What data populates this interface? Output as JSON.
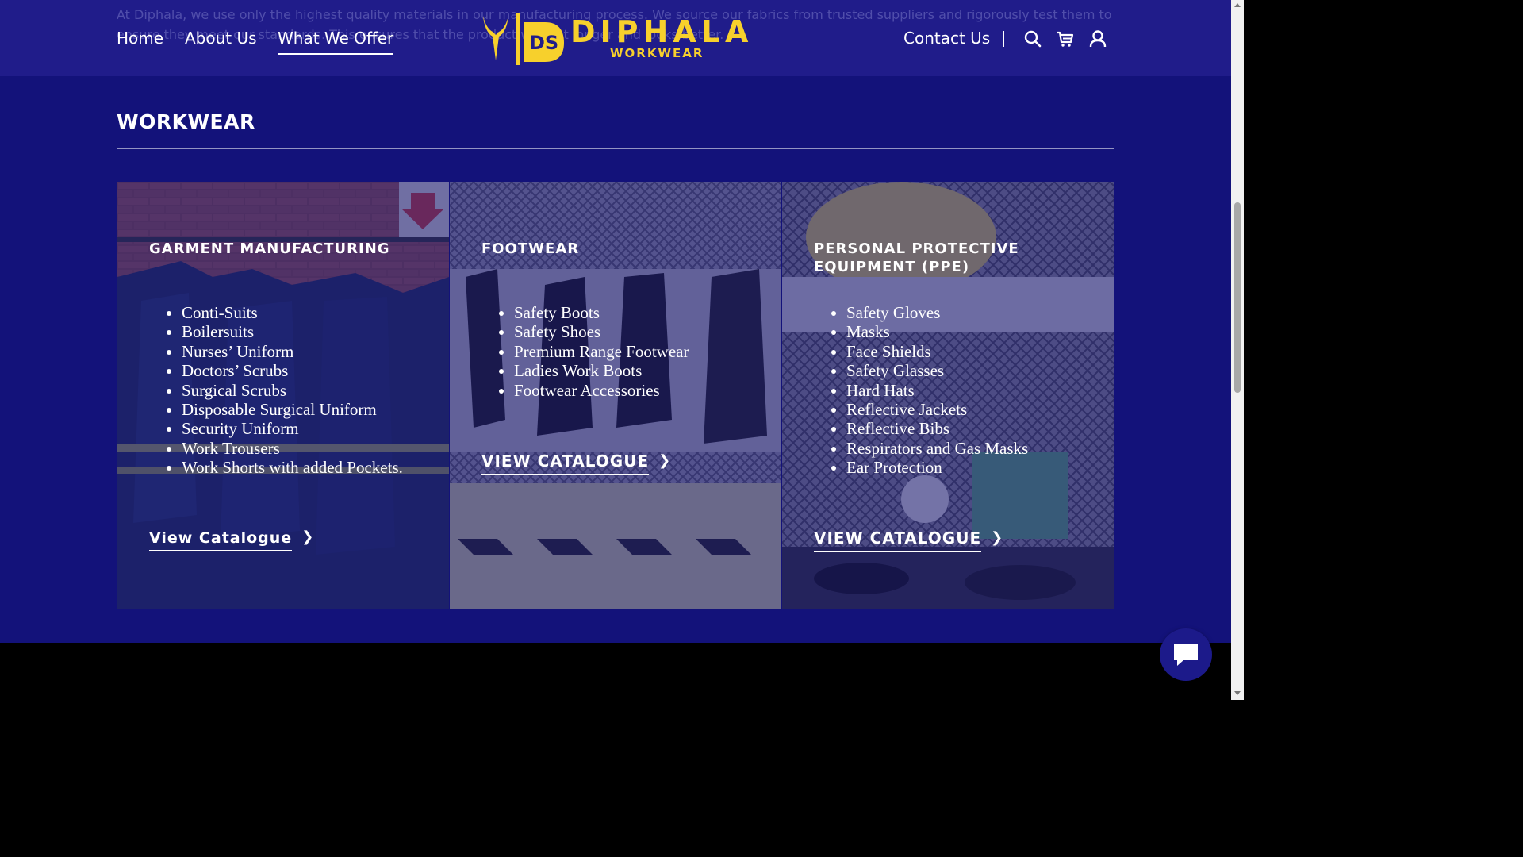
{
  "header": {
    "behind_text": "At Diphala, we use only the highest quality materials in our manufacturing process. We source our fabrics from trusted suppliers and rigorously test them to ensure they meet our standards. This ensures that the product will last longer and looks better.",
    "nav": {
      "home": "Home",
      "about": "About Us",
      "offer": "What We Offer",
      "contact": "Contact Us"
    },
    "logo": {
      "mark": "DS",
      "brand": "DIPHALA",
      "sub": "WORKWEAR"
    },
    "icons": [
      "search-icon",
      "cart-icon",
      "user-icon"
    ]
  },
  "section": {
    "title": "WORKWEAR"
  },
  "cards": [
    {
      "title": "GARMENT MANUFACTURING",
      "items": [
        "Conti-Suits",
        "Boilersuits",
        "Nurses’ Uniform",
        "Doctors’ Scrubs",
        "Surgical Scrubs",
        "Disposable Surgical Uniform",
        "Security Uniform",
        "Work Trousers",
        "Work Shorts with added Pockets."
      ],
      "link": "View Catalogue"
    },
    {
      "title": "FOOTWEAR",
      "items": [
        "Safety Boots",
        "Safety Shoes",
        "Premium Range Footwear",
        "Ladies Work Boots",
        "Footwear Accessories"
      ],
      "link": "VIEW CATALOGUE"
    },
    {
      "title": "PERSONAL PROTECTIVE EQUIPMENT (PPE)",
      "items": [
        "Safety Gloves",
        "Masks",
        "Face Shields",
        "Safety Glasses",
        "Hard Hats",
        "Reflective Jackets",
        "Reflective Bibs",
        "Respirators and Gas Masks",
        "Ear Protection"
      ],
      "link": "VIEW CATALOGUE"
    }
  ],
  "colors": {
    "header_bg": "#201c8a",
    "section_bg": "#13127a",
    "brand_yellow": "#f7d02c",
    "text": "#ffffff"
  }
}
